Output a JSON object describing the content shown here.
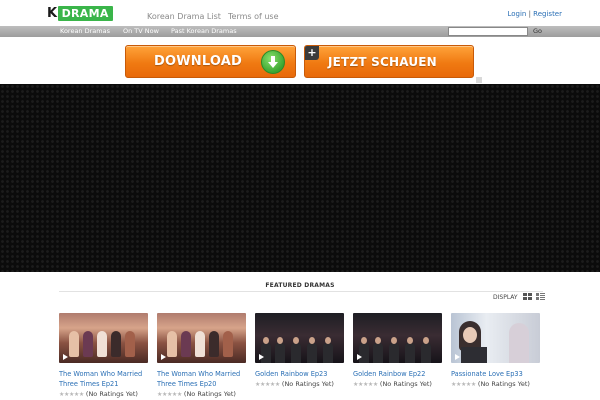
{
  "brand": {
    "logo_k": "K",
    "logo_drama": "DRAMA",
    "accent": "#3ab54a"
  },
  "top_nav": {
    "korean_drama_list": "Korean Drama List",
    "terms": "Terms of use"
  },
  "auth": {
    "login": "Login",
    "separator": "|",
    "register": "Register"
  },
  "nav_bar": {
    "items": [
      "Korean Dramas",
      "On TV Now",
      "Past Korean Dramas"
    ],
    "search_placeholder": "",
    "go_label": "Go"
  },
  "ads": {
    "download_label": "DOWNLOAD",
    "watch_label": "JETZT SCHAUEN",
    "plus_symbol": "+",
    "arrow_icon": "green-down-arrow-icon",
    "color": "#f07a12"
  },
  "featured": {
    "title": "FEATURED DRAMAS",
    "display_label": "DISPLAY",
    "cards": [
      {
        "title": "The Woman Who Married Three Times Ep21",
        "rating": "(No Ratings Yet)"
      },
      {
        "title": "The Woman Who Married Three Times Ep20",
        "rating": "(No Ratings Yet)"
      },
      {
        "title": "Golden Rainbow Ep23",
        "rating": "(No Ratings Yet)"
      },
      {
        "title": "Golden Rainbow Ep22",
        "rating": "(No Ratings Yet)"
      },
      {
        "title": "Passionate Love Ep33",
        "rating": "(No Ratings Yet)"
      }
    ],
    "link_color": "#2a6fb5"
  }
}
